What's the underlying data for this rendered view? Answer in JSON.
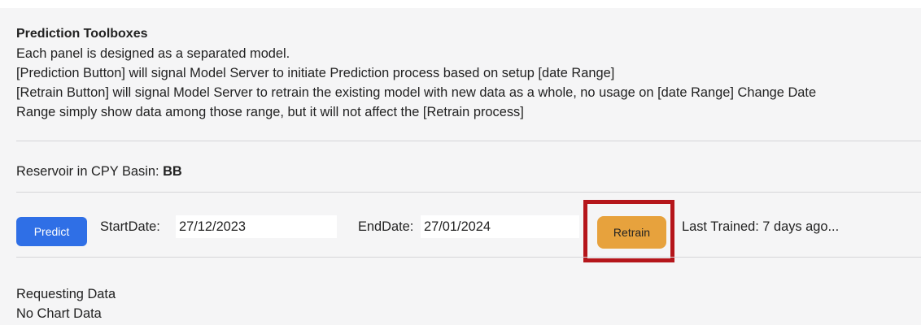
{
  "info": {
    "heading": "Prediction Toolboxes",
    "lines": [
      "Each panel is designed as a separated model.",
      "[Prediction Button] will signal Model Server to initiate Prediction process based on setup [date Range]",
      "[Retrain Button] will signal Model Server to retrain the existing model with new data as a whole, no usage on [date Range] Change Date",
      "Range simply show data among those range, but it will not affect the [Retrain process]"
    ]
  },
  "reservoir": {
    "label": "Reservoir in CPY Basin:",
    "value": "BB"
  },
  "controls": {
    "predict_label": "Predict",
    "start_label": "StartDate:",
    "start_value": "27/12/2023",
    "end_label": "EndDate:",
    "end_value": "27/01/2024",
    "retrain_label": "Retrain",
    "last_trained": "Last Trained: 7 days ago..."
  },
  "status": {
    "requesting": "Requesting Data",
    "chart": "No Chart Data"
  },
  "colors": {
    "predict_button": "#2f6fe6",
    "retrain_button": "#e7a23d",
    "highlight_box": "#b5161b",
    "panel_background": "#f5f5f6"
  }
}
